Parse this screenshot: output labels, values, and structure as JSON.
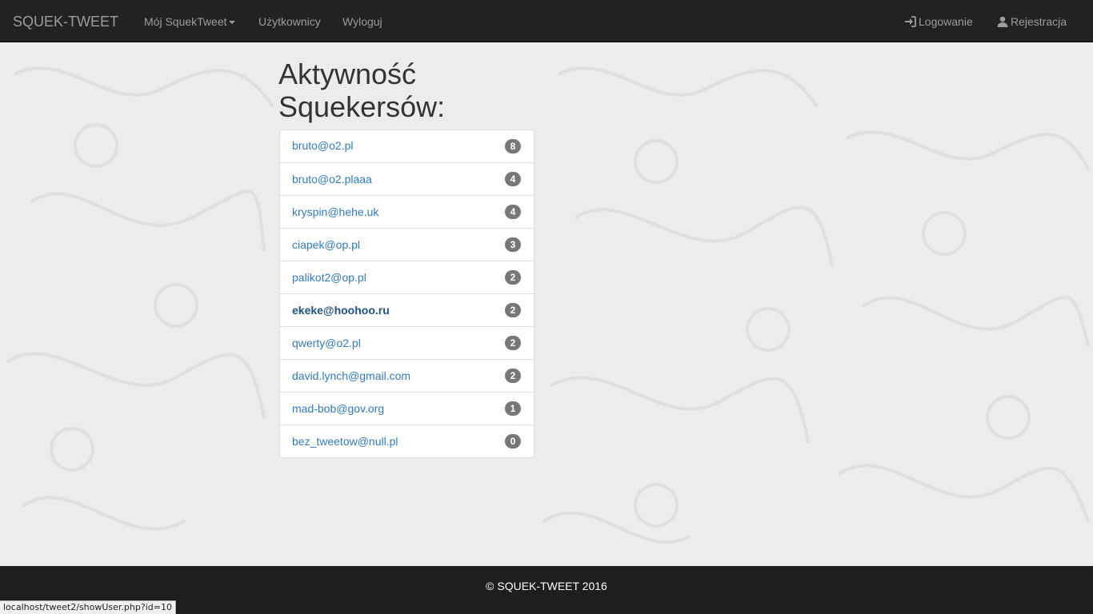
{
  "navbar": {
    "brand": "SQUEK-TWEET",
    "links": [
      {
        "label": "Mój SquekTweet"
      },
      {
        "label": "Użytkownicy"
      },
      {
        "label": "Wyloguj"
      }
    ],
    "right_links": [
      {
        "label": "Logowanie",
        "icon": "log-in-icon"
      },
      {
        "label": "Rejestracja",
        "icon": "user-icon"
      }
    ]
  },
  "main": {
    "title_line1": "Aktywność",
    "title_line2": "Squekersów:",
    "users": [
      {
        "email": "bruto@o2.pl",
        "count": "8"
      },
      {
        "email": "bruto@o2.plaaa",
        "count": "4"
      },
      {
        "email": "kryspin@hehe.uk",
        "count": "4"
      },
      {
        "email": "ciapek@op.pl",
        "count": "3"
      },
      {
        "email": "palikot2@op.pl",
        "count": "2"
      },
      {
        "email": "ekeke@hoohoo.ru",
        "count": "2"
      },
      {
        "email": "qwerty@o2.pl",
        "count": "2"
      },
      {
        "email": "david.lynch@gmail.com",
        "count": "2"
      },
      {
        "email": "mad-bob@gov.org",
        "count": "1"
      },
      {
        "email": "bez_tweetow@null.pl",
        "count": "0"
      }
    ]
  },
  "footer": {
    "text": "© SQUEK-TWEET 2016"
  },
  "status_bar": {
    "url": "localhost/tweet2/showUser.php?id=10"
  },
  "colors": {
    "navbar_bg": "#222222",
    "link": "#337ab7",
    "badge": "#777777",
    "footer_bg": "#1e1e1e"
  }
}
